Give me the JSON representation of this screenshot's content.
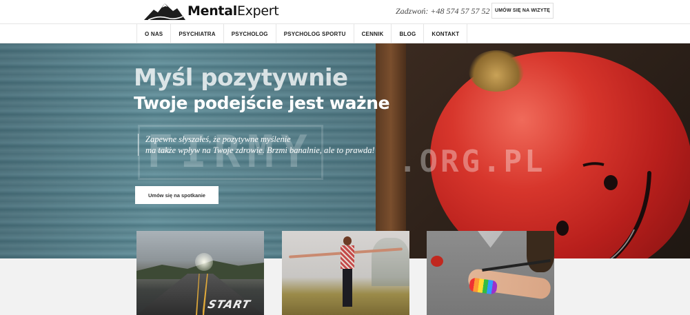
{
  "header": {
    "logo_part1": "Mental",
    "logo_part2": "Expert",
    "phone": "Zadzwoń: +48 574 57 57 52",
    "cta": "UMÓW SIĘ NA WIZYTĘ"
  },
  "nav": {
    "items": [
      {
        "label": "O NAS"
      },
      {
        "label": "PSYCHIATRA"
      },
      {
        "label": "PSYCHOLOG"
      },
      {
        "label": "PSYCHOLOG SPORTU"
      },
      {
        "label": "CENNIK"
      },
      {
        "label": "BLOG"
      },
      {
        "label": "KONTAKT"
      }
    ]
  },
  "hero": {
    "title": "Myśl pozytywnie",
    "subtitle": "Twoje podejście jest ważne",
    "desc_line1": "Zapewne słyszałeś, że pozytywne myślenie",
    "desc_line2": "ma także wpływ na Twoje zdrowie. Brzmi banalnie, ale to prawda!",
    "button": "Umów się na spotkanie"
  },
  "watermark": {
    "main": "FIRMY",
    "tail": ".ORG.PL"
  },
  "cards": [
    {
      "image": "road-start-photo",
      "overlay_text": "START"
    },
    {
      "image": "woman-arms-outstretched-photo"
    },
    {
      "image": "painted-rainbow-arm-photo"
    }
  ],
  "colors": {
    "apple_red": "#d7362c",
    "wood_teal": "#6d9aa5",
    "nav_text": "#222222"
  }
}
